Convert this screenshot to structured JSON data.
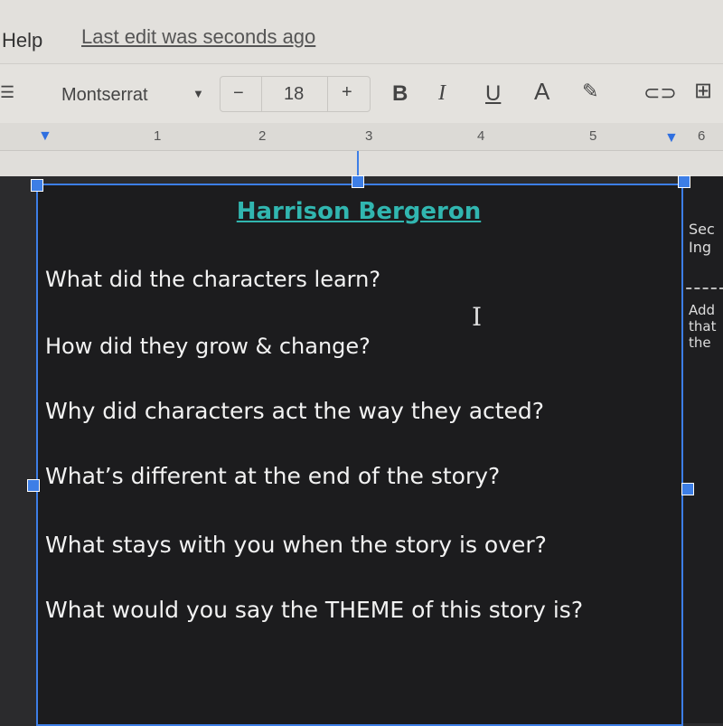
{
  "menu": {
    "help": "Help",
    "last_edit": "Last edit was seconds ago"
  },
  "toolbar": {
    "font": "Montserrat",
    "font_size": "18",
    "decrease": "−",
    "increase": "+",
    "bold": "B",
    "italic": "I",
    "underline": "U",
    "text_color": "A"
  },
  "ruler": {
    "marks": [
      "1",
      "2",
      "3",
      "4",
      "5",
      "6"
    ]
  },
  "document": {
    "title": "Harrison Bergeron",
    "questions": [
      "What did the characters learn?",
      "How did they grow & change?",
      "Why did characters act the way they acted?",
      "What’s different at the end of the story?",
      "What stays with you when the story is over?",
      "What would you say the THEME of this story is?"
    ],
    "side_lines_1": [
      "Sec",
      "Ing"
    ],
    "side_lines_2": [
      "Add",
      "that",
      "the"
    ]
  },
  "colors": {
    "title": "#31b6b0",
    "selection": "#3d7ee6",
    "textbox_bg": "#1c1c1e"
  }
}
